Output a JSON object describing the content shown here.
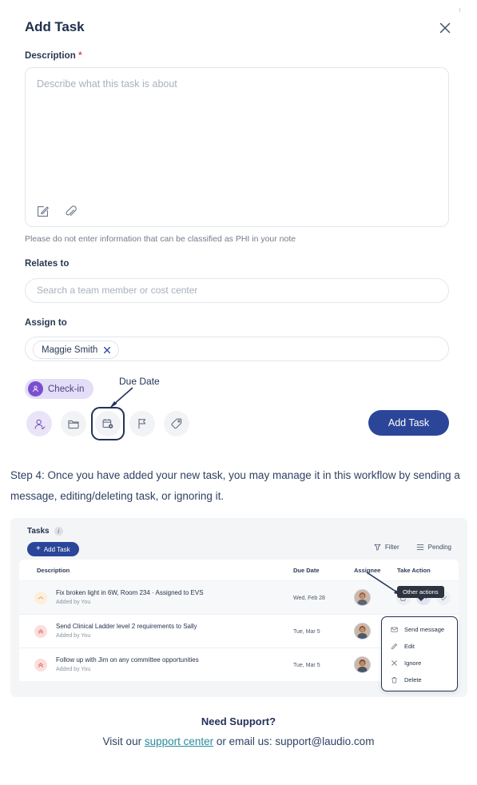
{
  "modal": {
    "title": "Add Task",
    "close_icon": "close-icon",
    "description": {
      "label": "Description",
      "required_mark": "*",
      "placeholder": "Describe what this task is about",
      "value": "",
      "tools": [
        "compose-icon",
        "attachment-icon"
      ]
    },
    "phi_note": "Please do not enter information that can be classified as PHI in your note",
    "relates_to": {
      "label": "Relates to",
      "placeholder": "Search a team member or cost center",
      "value": ""
    },
    "assign_to": {
      "label": "Assign to",
      "chip": "Maggie Smith",
      "chip_remove_icon": "close-icon"
    },
    "category_chip": {
      "label": "Check-in",
      "icon": "person-check-icon",
      "bg_color": "#e3ddf7",
      "avatar_color": "#7b4fce"
    },
    "icon_buttons": [
      {
        "name": "assignee-icon",
        "selected": false,
        "highlighted": true
      },
      {
        "name": "folder-icon",
        "selected": false,
        "highlighted": false
      },
      {
        "name": "calendar-due-date-icon",
        "selected": true,
        "highlighted": false
      },
      {
        "name": "flag-icon",
        "selected": false,
        "highlighted": false
      },
      {
        "name": "tag-icon",
        "selected": false,
        "highlighted": false
      }
    ],
    "annotation_due_date": "Due Date",
    "submit_label": "Add Task",
    "submit_color": "#2b4699"
  },
  "step_text": "Step 4: Once you have added your new task, you may manage it in this workflow by sending a message, editing/deleting task, or ignoring it.",
  "tasks_panel": {
    "title": "Tasks",
    "info_icon": "info-icon",
    "add_task_label": "Add Task",
    "filter_label": "Filter",
    "filter_icon": "funnel-icon",
    "pending_label": "Pending",
    "pending_icon": "list-icon",
    "columns": [
      "Description",
      "Due Date",
      "Assignee",
      "Take Action"
    ],
    "rows": [
      {
        "priority": "low",
        "description": "Fix broken light in 6W, Room 234 · Assigned to EVS",
        "added_by": "Added by You",
        "due_date": "Wed, Feb 28",
        "assignee_avatar": "avatar",
        "actions": [
          "open-external-icon",
          "more-actions-icon",
          "complete-check-icon"
        ]
      },
      {
        "priority": "high",
        "description": "Send Clinical Ladder level 2 requirements to Sally",
        "added_by": "Added by You",
        "due_date": "Tue, Mar 5",
        "assignee_avatar": "avatar",
        "actions": [
          "open-external-icon",
          "more-actions-icon",
          "complete-check-icon"
        ]
      },
      {
        "priority": "high",
        "description": "Follow up with Jim on any committee opportunities",
        "added_by": "Added by You",
        "due_date": "Tue, Mar 5",
        "assignee_avatar": "avatar",
        "actions": [
          "open-external-icon",
          "more-actions-icon",
          "complete-check-icon"
        ]
      }
    ],
    "tooltip": "Other actions",
    "dropdown": [
      {
        "label": "Send message",
        "icon": "envelope-icon"
      },
      {
        "label": "Edit",
        "icon": "pencil-icon"
      },
      {
        "label": "Ignore",
        "icon": "close-icon"
      },
      {
        "label": "Delete",
        "icon": "trash-icon"
      }
    ]
  },
  "support": {
    "heading": "Need Support?",
    "prefix": "Visit our ",
    "link": "support center",
    "suffix": " or email us: support@laudio.com",
    "link_color": "#2a8a9e"
  }
}
